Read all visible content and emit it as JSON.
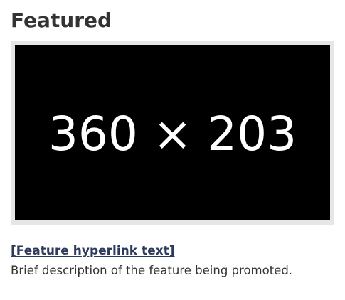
{
  "featured": {
    "title": "Featured",
    "image": {
      "placeholder_label": "360 × 203"
    },
    "link_text": "[Feature hyperlink text]",
    "description": "Brief description of the feature being promoted."
  },
  "colors": {
    "title": "#333333",
    "link": "#2e3a5c",
    "image_bg": "#000000",
    "image_border": "#e6e6e6",
    "placeholder_text": "#ffffff"
  }
}
